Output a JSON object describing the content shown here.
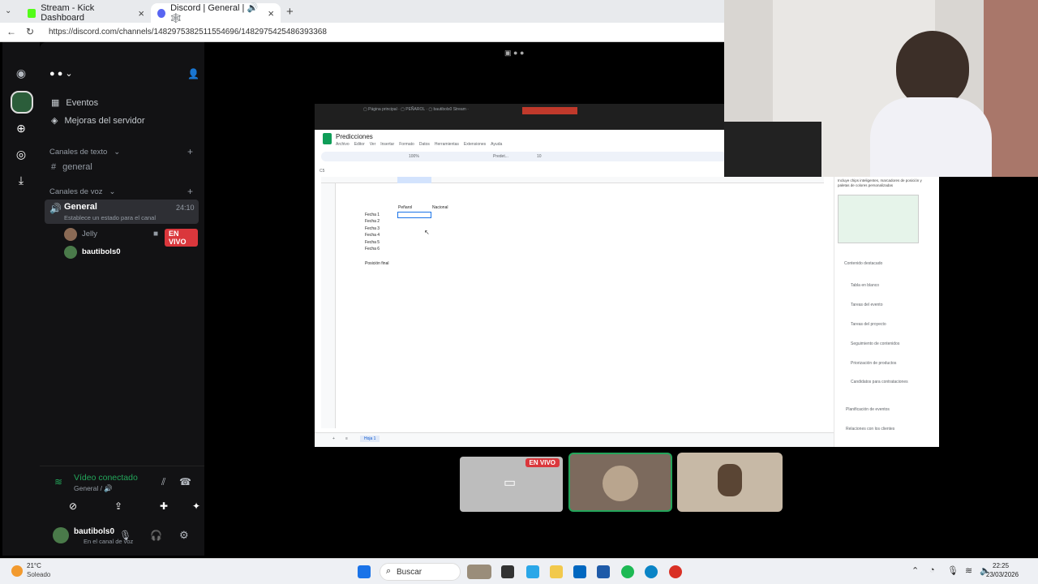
{
  "browser": {
    "tabs": [
      {
        "label": "Stream - Kick Dashboard"
      },
      {
        "label": "Discord | General | 🔊 🕸️"
      }
    ],
    "url": "https://discord.com/channels/1482975382511554696/1482975425486393368"
  },
  "discord": {
    "events_label": "Eventos",
    "boosts_label": "Mejoras del servidor",
    "text_category": "Canales de texto",
    "text_channel": "general",
    "voice_category": "Canales de voz",
    "voice_channel": "General",
    "voice_timer": "24:10",
    "voice_status": "Establece un estado para el canal",
    "members": [
      {
        "name": "Jelly",
        "live": "EN VIVO"
      },
      {
        "name": "bautibols0"
      }
    ],
    "video_status": "Vídeo conectado",
    "video_sub": "General / 🔊",
    "user_name": "bautibols0",
    "user_sub": "En el canal de voz",
    "live_badge": "EN VIVO"
  },
  "sheet": {
    "title": "Predicciones",
    "menu": [
      "Archivo",
      "Editor",
      "Ver",
      "Insertar",
      "Formato",
      "Datos",
      "Herramientas",
      "Extensiones",
      "Ayuda"
    ],
    "zoom": "100%",
    "font": "Predet...",
    "font_size": "10",
    "cell_ref": "C5",
    "headers": {
      "c": "Peñarol",
      "d": "Nacional"
    },
    "rows": [
      "Fecha 1",
      "Fecha 2",
      "Fecha 3",
      "Fecha 4",
      "Fecha 5",
      "Fecha 6"
    ],
    "final_label": "Posición final",
    "sheet_tab": "Hoja 1",
    "side_heading": "Contenido destacado",
    "side_items": [
      "Tabla en blanco",
      "Tareas del evento",
      "Tareas del proyecto",
      "Seguimiento de contenidos",
      "Priorización de productos",
      "Candidatos para contrataciones"
    ],
    "side_bottom": [
      "Planificación de eventos",
      "Relaciones con los clientes"
    ],
    "side_intro": "Incluye chips inteligentes, marcadores de posición y paletas de colores personalizadas"
  },
  "taskbar": {
    "weather_temp": "21°C",
    "weather_desc": "Soleado",
    "search": "Buscar",
    "time": "22:25",
    "date": "23/03/2026"
  },
  "colors": {
    "accent_green": "#23a55a",
    "live_red": "#da373c",
    "discord_bg": "#121214"
  }
}
